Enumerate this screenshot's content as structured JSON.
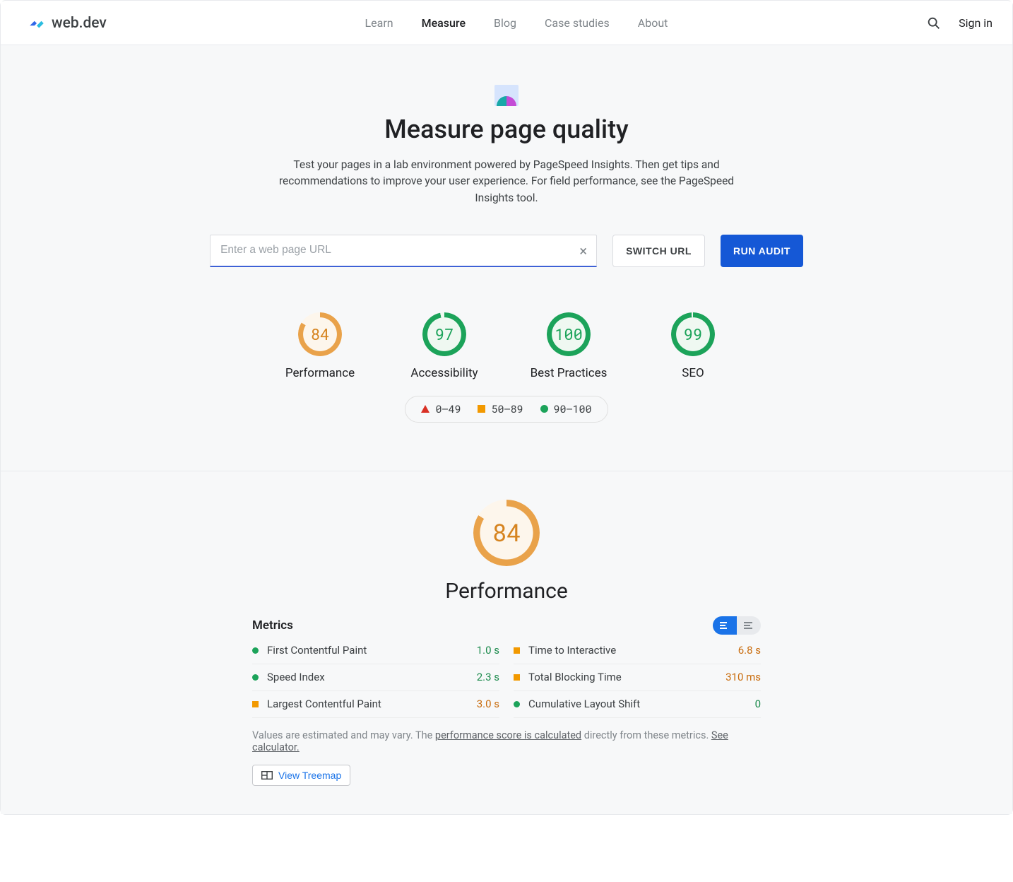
{
  "brand": {
    "name": "web.dev"
  },
  "nav": {
    "items": [
      {
        "id": "learn",
        "label": "Learn",
        "active": false
      },
      {
        "id": "measure",
        "label": "Measure",
        "active": true
      },
      {
        "id": "blog",
        "label": "Blog",
        "active": false
      },
      {
        "id": "case-studies",
        "label": "Case studies",
        "active": false
      },
      {
        "id": "about",
        "label": "About",
        "active": false
      }
    ]
  },
  "top_right": {
    "signin": "Sign in"
  },
  "hero": {
    "title": "Measure page quality",
    "subtitle": "Test your pages in a lab environment powered by PageSpeed Insights. Then get tips and recommendations to improve your user experience. For field performance, see the PageSpeed Insights tool."
  },
  "url_form": {
    "placeholder": "Enter a web page URL",
    "value": "",
    "switch_url": "SWITCH URL",
    "run_audit": "RUN AUDIT"
  },
  "gauges": [
    {
      "label": "Performance",
      "value": 84,
      "color": "orange",
      "arc_deg": 302
    },
    {
      "label": "Accessibility",
      "value": 97,
      "color": "green",
      "arc_deg": 349
    },
    {
      "label": "Best Practices",
      "value": 100,
      "color": "green",
      "arc_deg": 360
    },
    {
      "label": "SEO",
      "value": 99,
      "color": "green",
      "arc_deg": 356
    }
  ],
  "legend": {
    "low": "0–49",
    "mid": "50–89",
    "high": "90–100"
  },
  "performance": {
    "gauge": {
      "label": "Performance",
      "value": 84,
      "color": "orange",
      "arc_deg": 302
    },
    "metrics_title": "Metrics",
    "metrics": [
      {
        "name": "First Contentful Paint",
        "value": "1.0 s",
        "status": "good",
        "col": 0
      },
      {
        "name": "Time to Interactive",
        "value": "6.8 s",
        "status": "avg",
        "col": 1
      },
      {
        "name": "Speed Index",
        "value": "2.3 s",
        "status": "good",
        "col": 0
      },
      {
        "name": "Total Blocking Time",
        "value": "310 ms",
        "status": "avg",
        "col": 1
      },
      {
        "name": "Largest Contentful Paint",
        "value": "3.0 s",
        "status": "avg",
        "col": 0
      },
      {
        "name": "Cumulative Layout Shift",
        "value": "0",
        "status": "good",
        "col": 1
      }
    ],
    "footnote_prefix": "Values are estimated and may vary. The ",
    "footnote_link1": "performance score is calculated",
    "footnote_mid": " directly from these metrics. ",
    "footnote_link2": "See calculator.",
    "treemap": "View Treemap"
  }
}
